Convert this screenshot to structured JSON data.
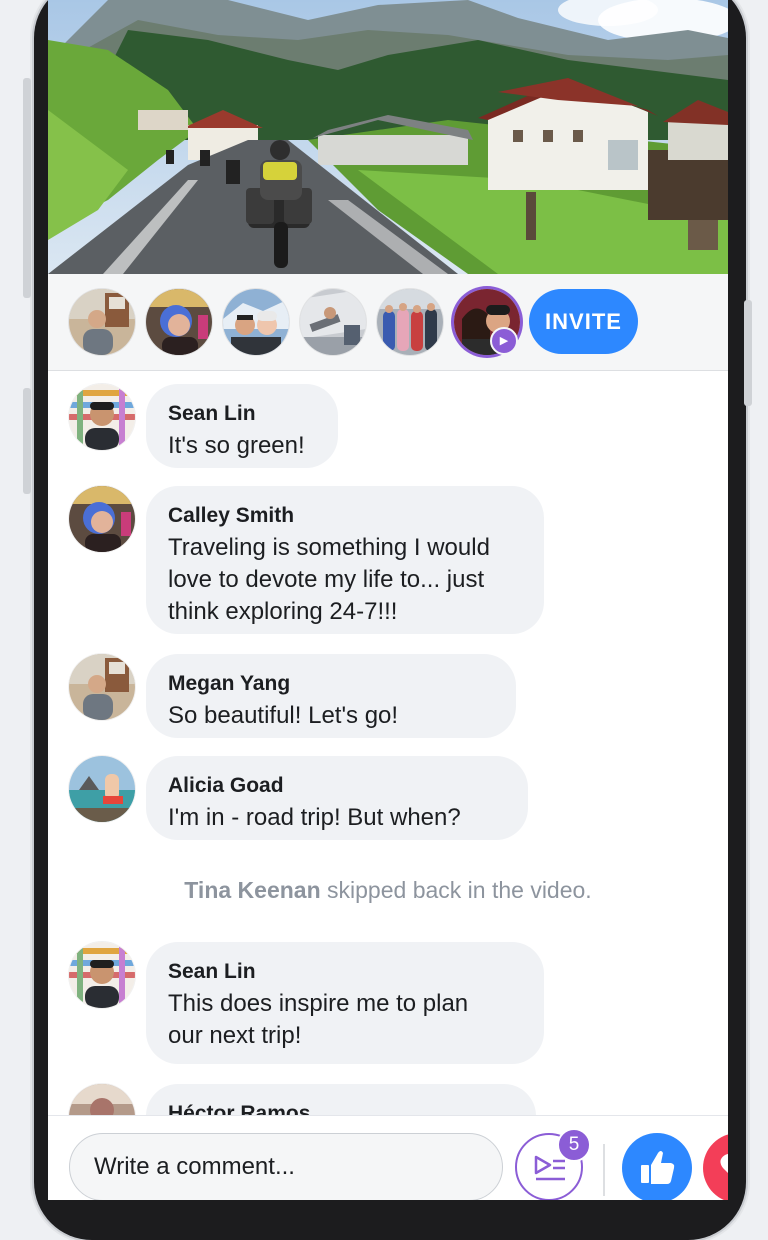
{
  "viewers": {
    "invite_label": "INVITE",
    "items": [
      {
        "icon": "avatar-man-boxes"
      },
      {
        "icon": "avatar-woman-blue-hair"
      },
      {
        "icon": "avatar-couple-selfie"
      },
      {
        "icon": "avatar-waterfront"
      },
      {
        "icon": "avatar-group-kimono"
      },
      {
        "icon": "avatar-couple-active",
        "badge_icon": "play-icon"
      }
    ]
  },
  "comments": [
    {
      "author": "Sean Lin",
      "text": "It's so green!"
    },
    {
      "author": "Calley Smith",
      "text": "Traveling is something I would\nlove to devote my life to... just\nthink exploring 24-7!!!"
    },
    {
      "author": "Megan Yang",
      "text": "So beautiful! Let's go!"
    },
    {
      "author": "Alicia Goad",
      "text": "I'm in - road trip! But when?"
    },
    {
      "author": "Sean Lin",
      "text": "This does inspire me to plan\nour next trip!"
    },
    {
      "author": "Héctor Ramos",
      "text": ""
    }
  ],
  "system_message": {
    "name": "Tina Keenan",
    "text": " skipped back in the video."
  },
  "composer": {
    "placeholder": "Write a comment...",
    "queue_count": "5",
    "like_icon": "thumbs-up-icon",
    "love_icon": "heart-icon"
  },
  "colors": {
    "accent": "#2d88ff",
    "purple": "#8b5dd6",
    "bubble": "#f0f2f5",
    "love": "#f33e58"
  }
}
